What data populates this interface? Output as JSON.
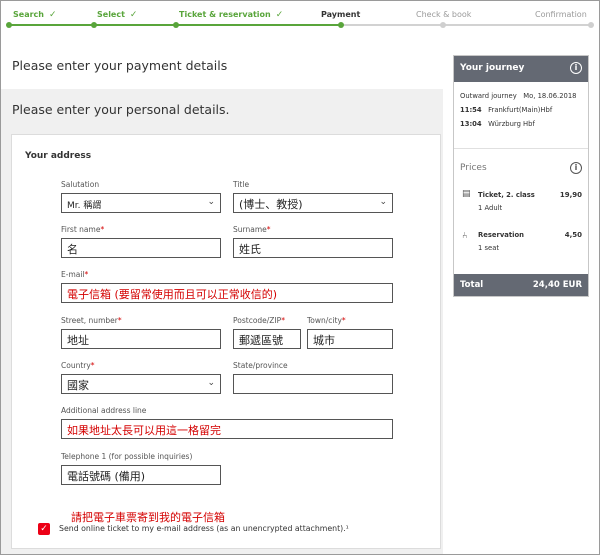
{
  "progress": {
    "steps": [
      {
        "label": "Search",
        "state": "done"
      },
      {
        "label": "Select",
        "state": "done"
      },
      {
        "label": "Ticket & reservation",
        "state": "done"
      },
      {
        "label": "Payment",
        "state": "current"
      },
      {
        "label": "Check & book",
        "state": "todo"
      },
      {
        "label": "Confirmation",
        "state": "todo"
      }
    ],
    "check_glyph": "✓"
  },
  "headings": {
    "payment": "Please enter your payment details",
    "personal": "Please enter your personal details."
  },
  "address": {
    "title": "Your address",
    "salutation": {
      "label": "Salutation",
      "value": "Mr. 稱謂"
    },
    "title_field": {
      "label": "Title",
      "value": "(博士、教授)"
    },
    "first_name": {
      "label": "First name",
      "value": "名"
    },
    "surname": {
      "label": "Surname",
      "value": "姓氏"
    },
    "email": {
      "label": "E-mail",
      "value": "電子信箱 (要留常使用而且可以正常收信的)"
    },
    "street": {
      "label": "Street, number",
      "value": "地址"
    },
    "postcode": {
      "label": "Postcode/ZIP",
      "value": "郵遞區號"
    },
    "town": {
      "label": "Town/city",
      "value": "城市"
    },
    "country": {
      "label": "Country",
      "value": "國家"
    },
    "state": {
      "label": "State/province",
      "value": ""
    },
    "additional": {
      "label": "Additional address line",
      "value": "如果地址太長可以用這一格留完"
    },
    "telephone": {
      "label": "Telephone 1 (for possible inquiries)",
      "value": "電話號碼 (備用)"
    },
    "required_mark": "*",
    "online_ticket_note": "請把電子車票寄到我的電子信箱",
    "online_ticket_label": "Send online ticket to my e-mail address (as an unencrypted attachment).¹",
    "online_ticket_checked": true
  },
  "journey": {
    "title": "Your journey",
    "outward_label": "Outward journey",
    "date": "Mo, 18.06.2018",
    "legs": [
      {
        "time": "11:54",
        "station": "Frankfurt(Main)Hbf"
      },
      {
        "time": "13:04",
        "station": "Würzburg Hbf"
      }
    ],
    "prices_title": "Prices",
    "items": [
      {
        "name": "Ticket, 2. class",
        "sub": "1 Adult",
        "price": "19,90",
        "icon": "ticket-icon"
      },
      {
        "name": "Reservation",
        "sub": "1 seat",
        "price": "4,50",
        "icon": "seat-icon"
      }
    ],
    "total_label": "Total",
    "total_value": "24,40 EUR"
  },
  "colors": {
    "accent_green": "#59a53b",
    "header_grey": "#646973",
    "red": "#ec0016"
  }
}
